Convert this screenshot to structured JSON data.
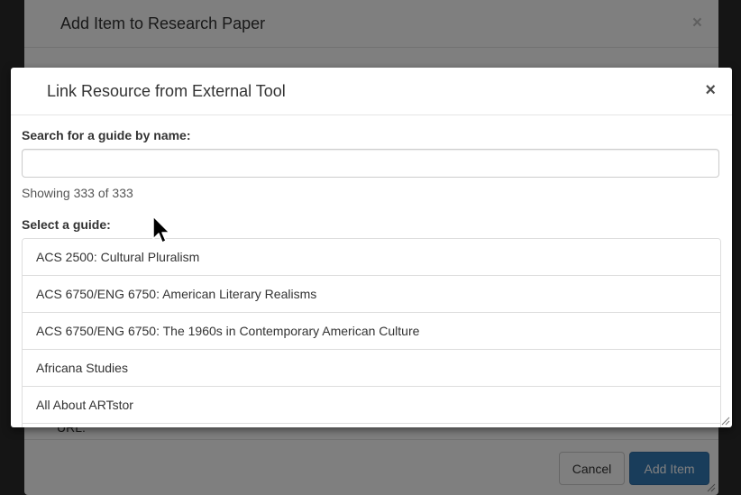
{
  "background_dialog": {
    "title": "Add Item to Research Paper",
    "close_glyph": "×",
    "partial_text": "URL:",
    "cancel_label": "Cancel",
    "add_label": "Add Item"
  },
  "modal": {
    "title": "Link Resource from External Tool",
    "close_glyph": "×",
    "search_label": "Search for a guide by name:",
    "search_value": "",
    "search_placeholder": "",
    "showing_text": "Showing 333 of 333",
    "select_label": "Select a guide:",
    "guides": [
      "ACS 2500: Cultural Pluralism",
      "ACS 6750/ENG 6750: American Literary Realisms",
      "ACS 6750/ENG 6750: The 1960s in Contemporary American Culture",
      "Africana Studies",
      "All About ARTstor"
    ]
  },
  "colors": {
    "primary": "#337ab7",
    "border": "#dddddd",
    "text": "#333333"
  },
  "icons": {
    "close": "close-icon",
    "resize": "resize-handle-icon",
    "cursor": "mouse-pointer-icon"
  }
}
